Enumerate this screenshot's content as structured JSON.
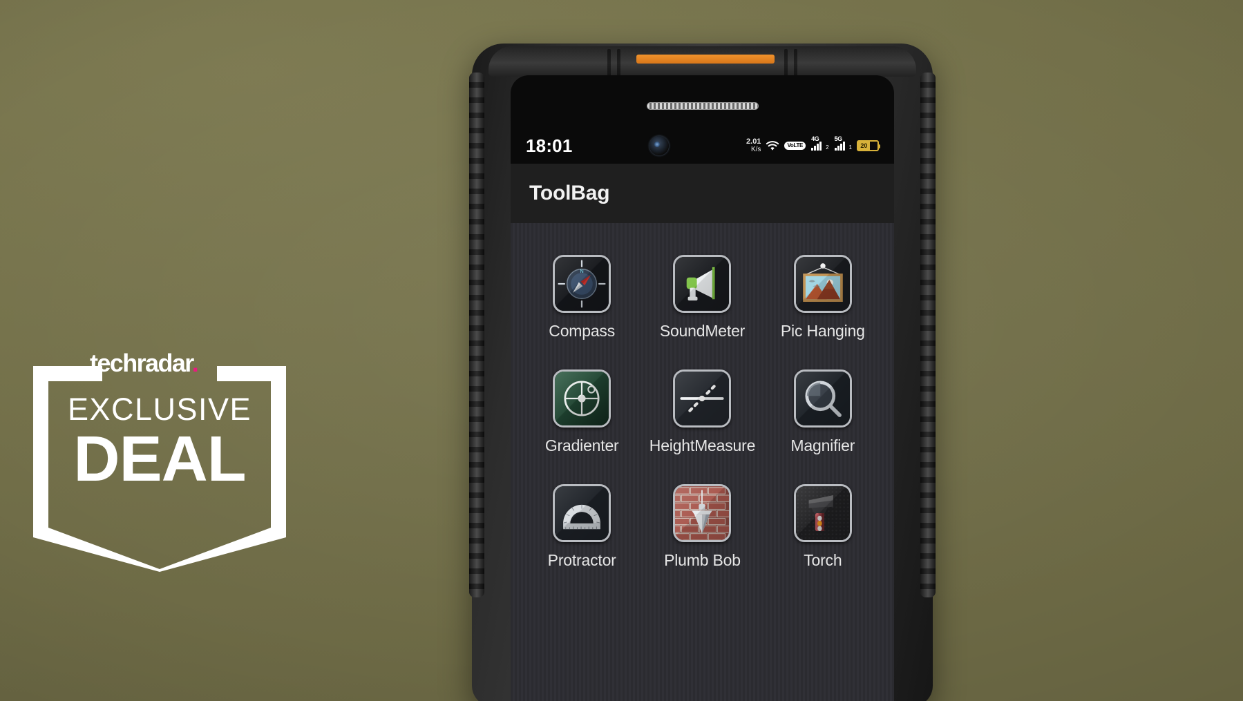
{
  "background": {
    "color_top": "#7d7a52",
    "color_bottom": "#6b6844"
  },
  "badge": {
    "brand": "techradar",
    "brand_dot": ".",
    "line1": "EXCLUSIVE",
    "line2": "DEAL",
    "accent_color": "#ea1a7f",
    "frame_color": "#ffffff"
  },
  "phone": {
    "accent_stripe_color": "#e8861f",
    "body_color": "#2c2c2c"
  },
  "statusbar": {
    "time": "18:01",
    "camera_icon": "front-camera-punch-hole",
    "net_speed_value": "2.01",
    "net_speed_unit": "K/s",
    "wifi_icon": "wifi-icon",
    "volte_label": "VoLTE",
    "sim1_label": "4G",
    "sim1_index": "2",
    "sim2_label": "5G",
    "sim2_index": "1",
    "battery_percent": "20",
    "battery_color": "#d8b23a"
  },
  "app": {
    "title": "ToolBag",
    "items": [
      {
        "label": "Compass",
        "icon": "compass-icon"
      },
      {
        "label": "SoundMeter",
        "icon": "megaphone-icon"
      },
      {
        "label": "Pic Hanging",
        "icon": "framed-picture-icon"
      },
      {
        "label": "Gradienter",
        "icon": "bubble-level-icon"
      },
      {
        "label": "HeightMeasure",
        "icon": "height-measure-icon"
      },
      {
        "label": "Magnifier",
        "icon": "magnifier-icon"
      },
      {
        "label": "Protractor",
        "icon": "protractor-icon"
      },
      {
        "label": "Plumb Bob",
        "icon": "plumb-bob-icon"
      },
      {
        "label": "Torch",
        "icon": "flashlight-icon"
      }
    ]
  }
}
